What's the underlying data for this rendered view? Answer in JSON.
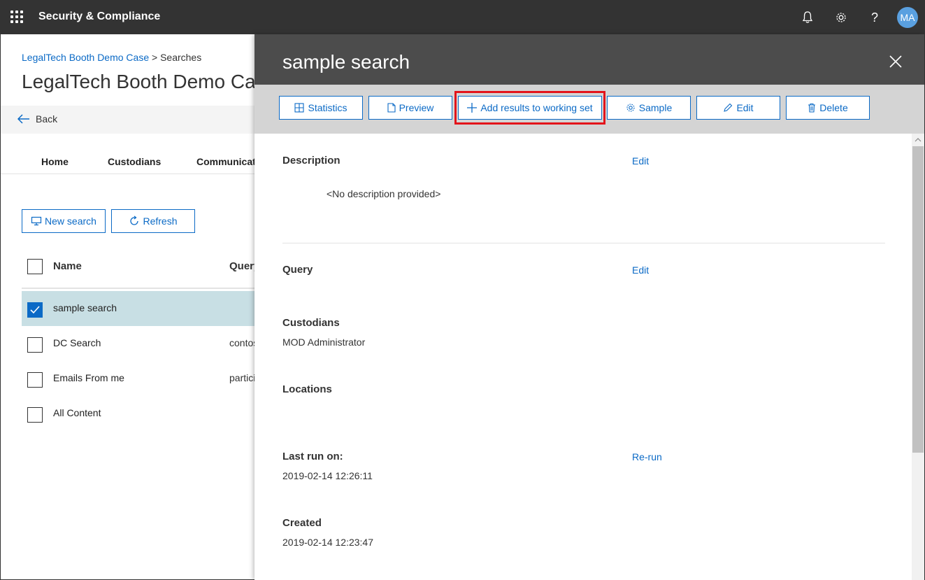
{
  "topbar": {
    "app_title": "Security & Compliance",
    "icons": [
      "waffle-icon",
      "bell-icon",
      "gear-icon",
      "help-icon"
    ],
    "help_glyph": "?",
    "avatar_initials": "MA"
  },
  "page": {
    "breadcrumb_link": "LegalTech Booth Demo Case",
    "breadcrumb_sep": ">",
    "breadcrumb_current": "Searches",
    "title": "LegalTech Booth Demo Case",
    "back_label": "Back",
    "tabs": [
      "Home",
      "Custodians",
      "Communications"
    ],
    "new_search_label": "New search",
    "refresh_label": "Refresh",
    "columns": {
      "name": "Name",
      "query": "Query"
    },
    "rows": [
      {
        "name": "sample search",
        "query": "",
        "checked": true
      },
      {
        "name": "DC Search",
        "query": "contoso",
        "checked": false
      },
      {
        "name": "Emails From me",
        "query": "participants",
        "checked": false
      },
      {
        "name": "All Content",
        "query": "",
        "checked": false
      }
    ]
  },
  "panel": {
    "title": "sample search",
    "commands": {
      "statistics": "Statistics",
      "preview": "Preview",
      "add_results": "Add results to working set",
      "sample": "Sample",
      "edit": "Edit",
      "delete": "Delete"
    },
    "description_label": "Description",
    "description_edit": "Edit",
    "description_value": "<No description provided>",
    "query_label": "Query",
    "query_edit": "Edit",
    "custodians_label": "Custodians",
    "custodians_value": "MOD Administrator",
    "locations_label": "Locations",
    "last_run_label": "Last run on:",
    "rerun_label": "Re-run",
    "last_run_value": "2019-02-14 12:26:11",
    "created_label": "Created",
    "created_value": "2019-02-14 12:23:47"
  },
  "colors": {
    "accent": "#0b6ac6",
    "highlight": "#e3141b",
    "topbar": "#333333",
    "panel_header": "#4c4c4c"
  }
}
